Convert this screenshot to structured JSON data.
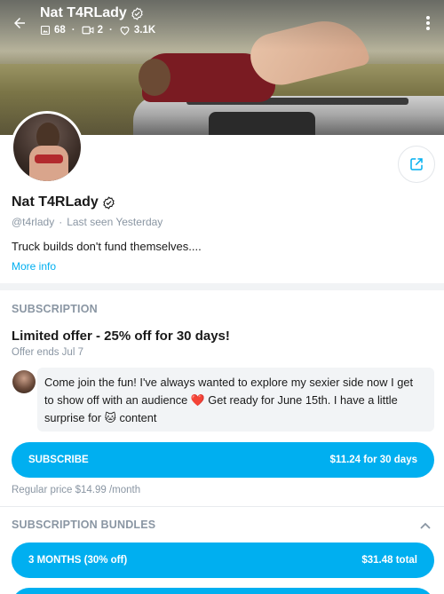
{
  "header": {
    "name": "Nat T4RLady",
    "stats": {
      "photos": "68",
      "videos": "2",
      "likes": "3.1K"
    }
  },
  "profile": {
    "name": "Nat T4RLady",
    "handle": "@t4rlady",
    "separator": "·",
    "last_seen": "Last seen Yesterday",
    "bio": "Truck builds don't fund themselves....",
    "more_info": "More info"
  },
  "subscription": {
    "section_title": "SUBSCRIPTION",
    "offer_title": "Limited offer - 25% off for 30 days!",
    "offer_ends": "Offer ends Jul 7",
    "message": {
      "part1": "Come join the fun! I've always wanted to explore my sexier side now I get to show off with an audience ",
      "heart_emoji": "❤️",
      "part2": " Get ready for June 15th. I have a little surprise for ",
      "cat_emoji": "🐱",
      "part3": " content"
    },
    "subscribe_label": "SUBSCRIBE",
    "subscribe_price": "$11.24 for 30 days",
    "regular_price": "Regular price $14.99 /month"
  },
  "bundles": {
    "section_title": "SUBSCRIPTION BUNDLES",
    "items": [
      {
        "label": "3 MONTHS (30% off)",
        "price": "$31.48 total"
      }
    ]
  },
  "colors": {
    "accent": "#00aff0",
    "muted": "#8a96a3",
    "heart": "#e0192b"
  }
}
